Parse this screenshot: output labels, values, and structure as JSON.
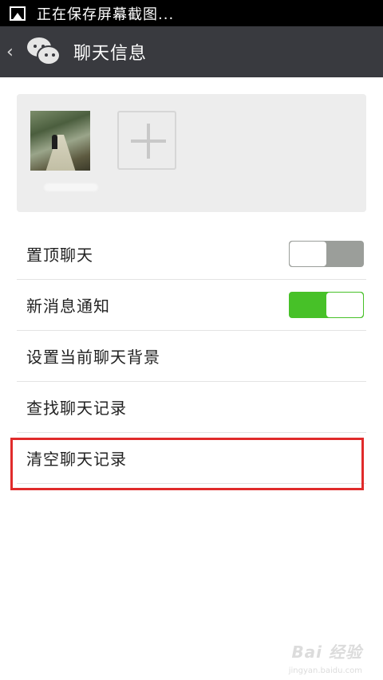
{
  "status_bar": {
    "text": "正在保存屏幕截图..."
  },
  "header": {
    "title": "聊天信息"
  },
  "settings": [
    {
      "label": "置顶聊天",
      "toggle": "off"
    },
    {
      "label": "新消息通知",
      "toggle": "on"
    },
    {
      "label": "设置当前聊天背景"
    },
    {
      "label": "查找聊天记录"
    },
    {
      "label": "清空聊天记录"
    }
  ],
  "watermark": {
    "text": "Bai 经验",
    "sub": "jingyan.baidu.com"
  },
  "colors": {
    "toggle_on": "#47c128",
    "header": "#393a3f",
    "highlight": "#e02b2b"
  },
  "icons": [
    "image-icon",
    "back-icon",
    "wechat-logo-icon",
    "add-member-icon"
  ]
}
